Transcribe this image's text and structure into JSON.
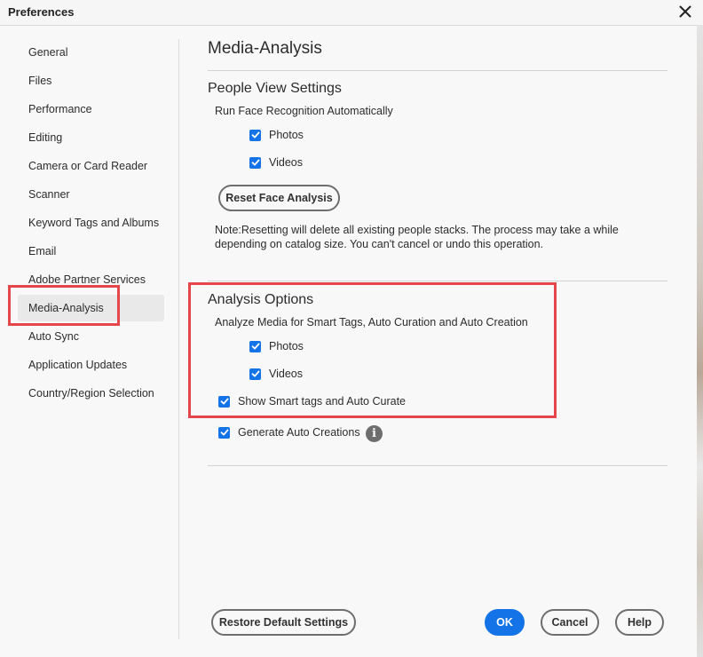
{
  "window": {
    "title": "Preferences",
    "close_icon": "close-icon"
  },
  "sidebar": {
    "items": [
      {
        "label": "General"
      },
      {
        "label": "Files"
      },
      {
        "label": "Performance"
      },
      {
        "label": "Editing"
      },
      {
        "label": "Camera or Card Reader"
      },
      {
        "label": "Scanner"
      },
      {
        "label": "Keyword Tags and Albums"
      },
      {
        "label": "Email"
      },
      {
        "label": "Adobe Partner Services"
      },
      {
        "label": "Media-Analysis",
        "selected": true
      },
      {
        "label": "Auto Sync"
      },
      {
        "label": "Application Updates"
      },
      {
        "label": "Country/Region Selection"
      }
    ]
  },
  "main": {
    "title": "Media-Analysis",
    "people_view": {
      "heading": "People View Settings",
      "subtext": "Run Face Recognition Automatically",
      "photos": {
        "label": "Photos",
        "checked": true
      },
      "videos": {
        "label": "Videos",
        "checked": true
      },
      "reset_button": "Reset Face Analysis",
      "note": "Note:Resetting will delete all existing people stacks. The process may take a while depending on catalog size. You can't cancel or undo this operation."
    },
    "analysis_options": {
      "heading": "Analysis Options",
      "subtext": "Analyze Media for Smart Tags, Auto Curation and Auto Creation",
      "photos": {
        "label": "Photos",
        "checked": true
      },
      "videos": {
        "label": "Videos",
        "checked": true
      },
      "smart_tags": {
        "label": "Show Smart tags and Auto Curate",
        "checked": true
      },
      "auto_creations": {
        "label": "Generate Auto Creations",
        "checked": true,
        "info_icon": "info-icon"
      }
    }
  },
  "footer": {
    "restore_button": "Restore Default Settings",
    "ok_button": "OK",
    "cancel_button": "Cancel",
    "help_button": "Help"
  },
  "colors": {
    "accent": "#1473e6",
    "highlight": "#e5464b"
  }
}
